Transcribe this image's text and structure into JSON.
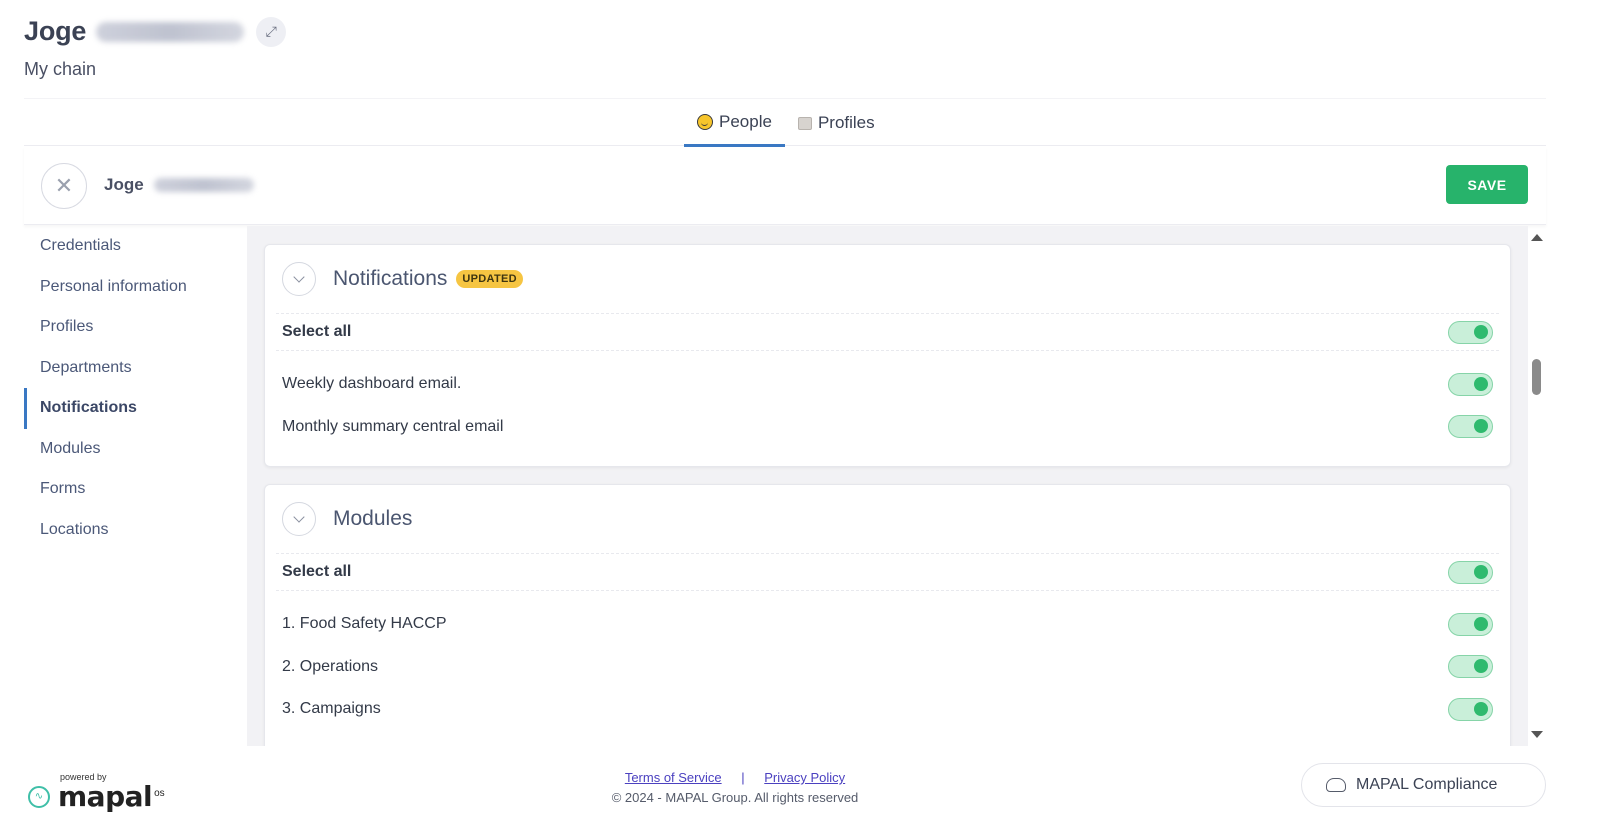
{
  "header": {
    "user_name": "Joge",
    "subtitle": "My chain"
  },
  "tabs": [
    {
      "label": "People",
      "active": true,
      "icon": "smiley-icon"
    },
    {
      "label": "Profiles",
      "active": false,
      "icon": "box-icon"
    }
  ],
  "edit_bar": {
    "name": "Joge",
    "save_label": "SAVE"
  },
  "sidebar": {
    "items": [
      {
        "label": "Credentials",
        "active": false
      },
      {
        "label": "Personal information",
        "active": false
      },
      {
        "label": "Profiles",
        "active": false
      },
      {
        "label": "Departments",
        "active": false
      },
      {
        "label": "Notifications",
        "active": true
      },
      {
        "label": "Modules",
        "active": false
      },
      {
        "label": "Forms",
        "active": false
      },
      {
        "label": "Locations",
        "active": false
      }
    ]
  },
  "notifications_card": {
    "title": "Notifications",
    "badge": "UPDATED",
    "select_all": "Select all",
    "select_all_on": true,
    "items": [
      {
        "label": "Weekly dashboard email.",
        "on": true
      },
      {
        "label": "Monthly summary central email",
        "on": true
      }
    ]
  },
  "modules_card": {
    "title": "Modules",
    "select_all": "Select all",
    "select_all_on": true,
    "items": [
      {
        "label": "1. Food Safety HACCP",
        "on": true
      },
      {
        "label": "2. Operations",
        "on": true
      },
      {
        "label": "3. Campaigns",
        "on": true
      }
    ]
  },
  "footer": {
    "powered_by": "powered by",
    "brand": "mapal",
    "brand_suffix": "os",
    "terms": "Terms of Service",
    "separator": "|",
    "privacy": "Privacy Policy",
    "copyright": "© 2024 - MAPAL Group. All rights reserved",
    "compliance_button": "MAPAL Compliance"
  },
  "colors": {
    "accent": "#3a78c3",
    "save": "#27b36b",
    "toggle_on": "#2fba6e",
    "badge": "#f6c542"
  }
}
